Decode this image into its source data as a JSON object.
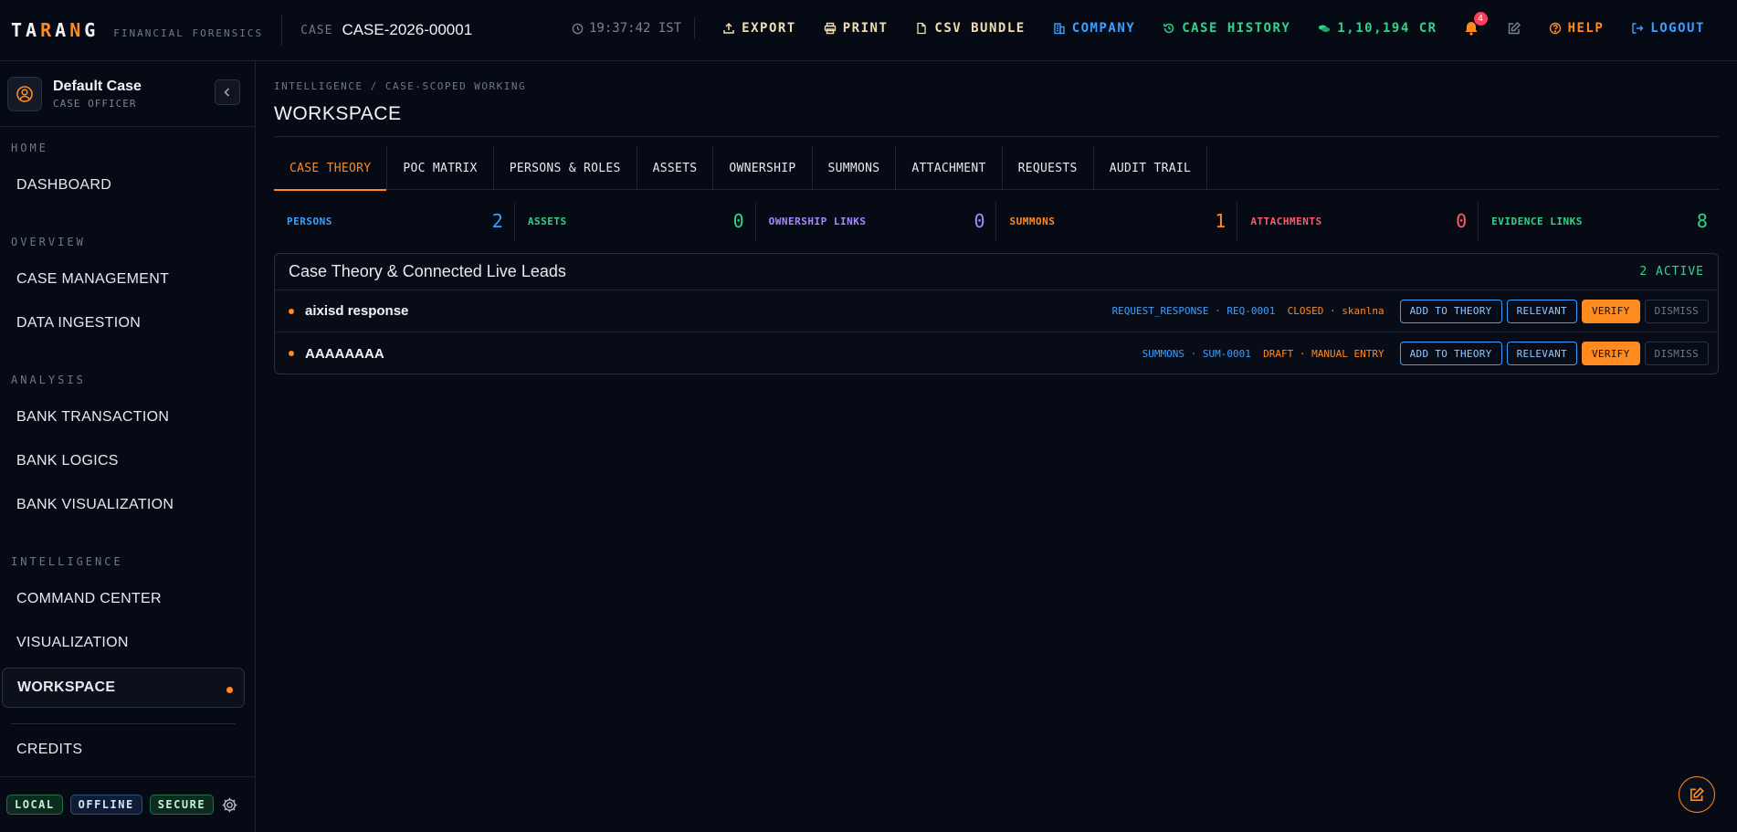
{
  "brand": {
    "logo_pre": "TA",
    "logo_accent1": "R",
    "logo_mid": "A",
    "logo_accent2": "N",
    "logo_post": "G",
    "tagline": "FINANCIAL FORENSICS"
  },
  "case": {
    "label": "CASE",
    "id": "CASE-2026-00001"
  },
  "topbar": {
    "clock": "19:37:42 IST",
    "export": "EXPORT",
    "print": "PRINT",
    "csv": "CSV BUNDLE",
    "company": "COMPANY",
    "history": "CASE HISTORY",
    "credits": "1,10,194 CR",
    "notifications": "4",
    "help": "HELP",
    "logout": "LOGOUT"
  },
  "user": {
    "name": "Default Case",
    "role": "CASE OFFICER"
  },
  "sidebar": {
    "sections": {
      "home": "HOME",
      "overview": "OVERVIEW",
      "analysis": "ANALYSIS",
      "intelligence": "INTELLIGENCE"
    },
    "items": {
      "dashboard": "DASHBOARD",
      "case_management": "CASE MANAGEMENT",
      "data_ingestion": "DATA INGESTION",
      "bank_transaction": "BANK TRANSACTION",
      "bank_logics": "BANK LOGICS",
      "bank_visualization": "BANK VISUALIZATION",
      "command_center": "COMMAND CENTER",
      "visualization": "VISUALIZATION",
      "workspace": "WORKSPACE",
      "credits": "CREDITS"
    },
    "status": {
      "local": "LOCAL",
      "offline": "OFFLINE",
      "secure": "SECURE"
    }
  },
  "main": {
    "breadcrumb": "INTELLIGENCE / CASE-SCOPED WORKING",
    "title": "WORKSPACE",
    "tabs": [
      "CASE THEORY",
      "POC MATRIX",
      "PERSONS & ROLES",
      "ASSETS",
      "OWNERSHIP",
      "SUMMONS",
      "ATTACHMENT",
      "REQUESTS",
      "AUDIT TRAIL"
    ],
    "stats": [
      {
        "label": "PERSONS",
        "value": "2",
        "color": "#3aa0ff"
      },
      {
        "label": "ASSETS",
        "value": "0",
        "color": "#2fd488"
      },
      {
        "label": "OWNERSHIP LINKS",
        "value": "0",
        "color": "#a58bff"
      },
      {
        "label": "SUMMONS",
        "value": "1",
        "color": "#ff8a1f"
      },
      {
        "label": "ATTACHMENTS",
        "value": "0",
        "color": "#ff5a6a"
      },
      {
        "label": "EVIDENCE LINKS",
        "value": "8",
        "color": "#2fd488"
      }
    ],
    "panel": {
      "title": "Case Theory & Connected Live Leads",
      "count": "2 ACTIVE",
      "leads": [
        {
          "name": "aixisd response",
          "ref": "REQUEST_RESPONSE · REQ-0001",
          "status": "CLOSED · skanlna"
        },
        {
          "name": "AAAAAAAA",
          "ref": "SUMMONS · SUM-0001",
          "status": "DRAFT · MANUAL ENTRY"
        }
      ],
      "buttons": {
        "add": "ADD TO THEORY",
        "relevant": "RELEVANT",
        "verify": "VERIFY",
        "dismiss": "DISMISS"
      }
    }
  },
  "colors": {
    "accent": "#ff8a1f",
    "blue": "#3aa0ff",
    "green": "#2fd488",
    "bg": "#060a15"
  }
}
